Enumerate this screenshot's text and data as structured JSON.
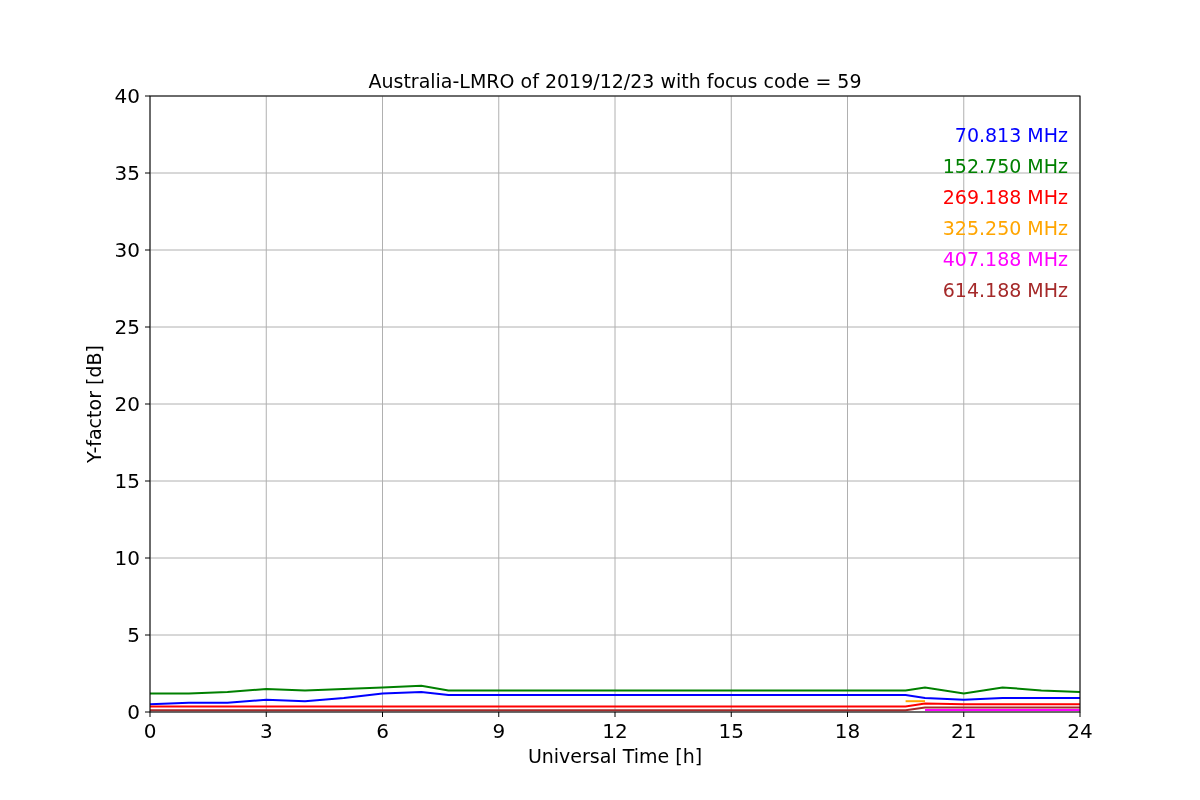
{
  "chart_data": {
    "type": "line",
    "title": "Australia-LMRO of 2019/12/23 with focus code = 59",
    "xlabel": "Universal Time [h]",
    "ylabel": "Y-factor [dB]",
    "x": [
      0,
      1,
      2,
      3,
      4,
      5,
      6,
      7,
      7.7,
      19.5,
      20,
      21,
      22,
      23,
      24
    ],
    "grid": true,
    "xlim": [
      0,
      24
    ],
    "ylim": [
      0,
      40
    ],
    "xticks": [
      0,
      3,
      6,
      9,
      12,
      15,
      18,
      21,
      24
    ],
    "yticks": [
      0,
      5,
      10,
      15,
      20,
      25,
      30,
      35,
      40
    ],
    "series": [
      {
        "name": "70.813 MHz",
        "color": "#0000ff",
        "values": [
          0.5,
          0.6,
          0.6,
          0.8,
          0.7,
          0.9,
          1.2,
          1.3,
          1.1,
          1.1,
          0.9,
          0.8,
          0.9,
          0.9,
          0.9
        ]
      },
      {
        "name": "152.750 MHz",
        "color": "#008000",
        "values": [
          1.2,
          1.2,
          1.3,
          1.5,
          1.4,
          1.5,
          1.6,
          1.7,
          1.4,
          1.4,
          1.6,
          1.2,
          1.6,
          1.4,
          1.3
        ]
      },
      {
        "name": "269.188 MHz",
        "color": "#ff0000",
        "values": [
          0.35,
          0.35,
          0.35,
          0.35,
          0.35,
          0.35,
          0.35,
          0.35,
          0.35,
          0.35,
          0.55,
          0.5,
          0.5,
          0.5,
          0.5
        ]
      },
      {
        "name": "325.250 MHz",
        "color": "#ffa500",
        "values": [
          null,
          null,
          null,
          null,
          null,
          null,
          null,
          null,
          null,
          0.7,
          0.7,
          null,
          null,
          null,
          null
        ]
      },
      {
        "name": "407.188 MHz",
        "color": "#ff00ff",
        "values": [
          null,
          null,
          null,
          null,
          null,
          null,
          null,
          null,
          null,
          null,
          0.13,
          0.13,
          0.13,
          0.13,
          0.13
        ]
      },
      {
        "name": "614.188 MHz",
        "color": "#a52a2a",
        "values": [
          0.12,
          0.12,
          0.12,
          0.12,
          0.12,
          0.12,
          0.12,
          0.12,
          0.12,
          0.12,
          0.3,
          0.3,
          0.3,
          0.3,
          0.3
        ]
      }
    ]
  }
}
